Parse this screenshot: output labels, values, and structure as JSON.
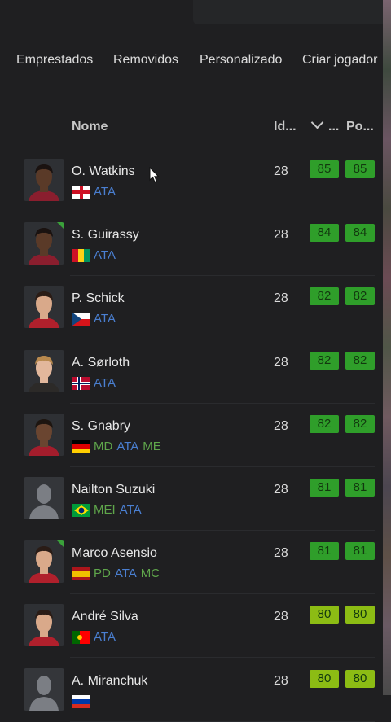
{
  "colors": {
    "background": "#1f1f21",
    "rating_dark_green": "#2f9e2a",
    "rating_light_green": "#8cbc14",
    "position_attack": "#4a7fd1",
    "position_mid": "#5fa64b"
  },
  "tabs": [
    "Emprestados",
    "Removidos",
    "Personalizado",
    "Criar jogador"
  ],
  "header": {
    "name": "Nome",
    "age": "Id...",
    "overall": "...",
    "potential": "Po..."
  },
  "players": [
    {
      "name": "O. Watkins",
      "flag": "england",
      "positions": [
        "ATA"
      ],
      "age": "28",
      "overall": "85",
      "potential": "85",
      "avatar_style": "dark",
      "corner": false
    },
    {
      "name": "S. Guirassy",
      "flag": "guinea",
      "positions": [
        "ATA"
      ],
      "age": "28",
      "overall": "84",
      "potential": "84",
      "avatar_style": "dark",
      "corner": true
    },
    {
      "name": "P. Schick",
      "flag": "czech",
      "positions": [
        "ATA"
      ],
      "age": "28",
      "overall": "82",
      "potential": "82",
      "avatar_style": "light",
      "corner": false
    },
    {
      "name": "A. Sørloth",
      "flag": "norway",
      "positions": [
        "ATA"
      ],
      "age": "28",
      "overall": "82",
      "potential": "82",
      "avatar_style": "blond",
      "corner": false
    },
    {
      "name": "S. Gnabry",
      "flag": "germany",
      "positions": [
        "MD",
        "ATA",
        "ME"
      ],
      "age": "28",
      "overall": "82",
      "potential": "82",
      "avatar_style": "dark-curly",
      "corner": false
    },
    {
      "name": "Nailton Suzuki",
      "flag": "brazil",
      "positions": [
        "MEI",
        "ATA"
      ],
      "age": "28",
      "overall": "81",
      "potential": "81",
      "avatar_style": "silhouette",
      "corner": false
    },
    {
      "name": "Marco Asensio",
      "flag": "spain",
      "positions": [
        "PD",
        "ATA",
        "MC"
      ],
      "age": "28",
      "overall": "81",
      "potential": "81",
      "avatar_style": "light",
      "corner": true
    },
    {
      "name": "André Silva",
      "flag": "portugal",
      "positions": [
        "ATA"
      ],
      "age": "28",
      "overall": "80",
      "potential": "80",
      "avatar_style": "light",
      "corner": false
    },
    {
      "name": "A. Miranchuk",
      "flag": "russia",
      "positions": [],
      "age": "28",
      "overall": "80",
      "potential": "80",
      "avatar_style": "silhouette",
      "corner": false
    }
  ]
}
